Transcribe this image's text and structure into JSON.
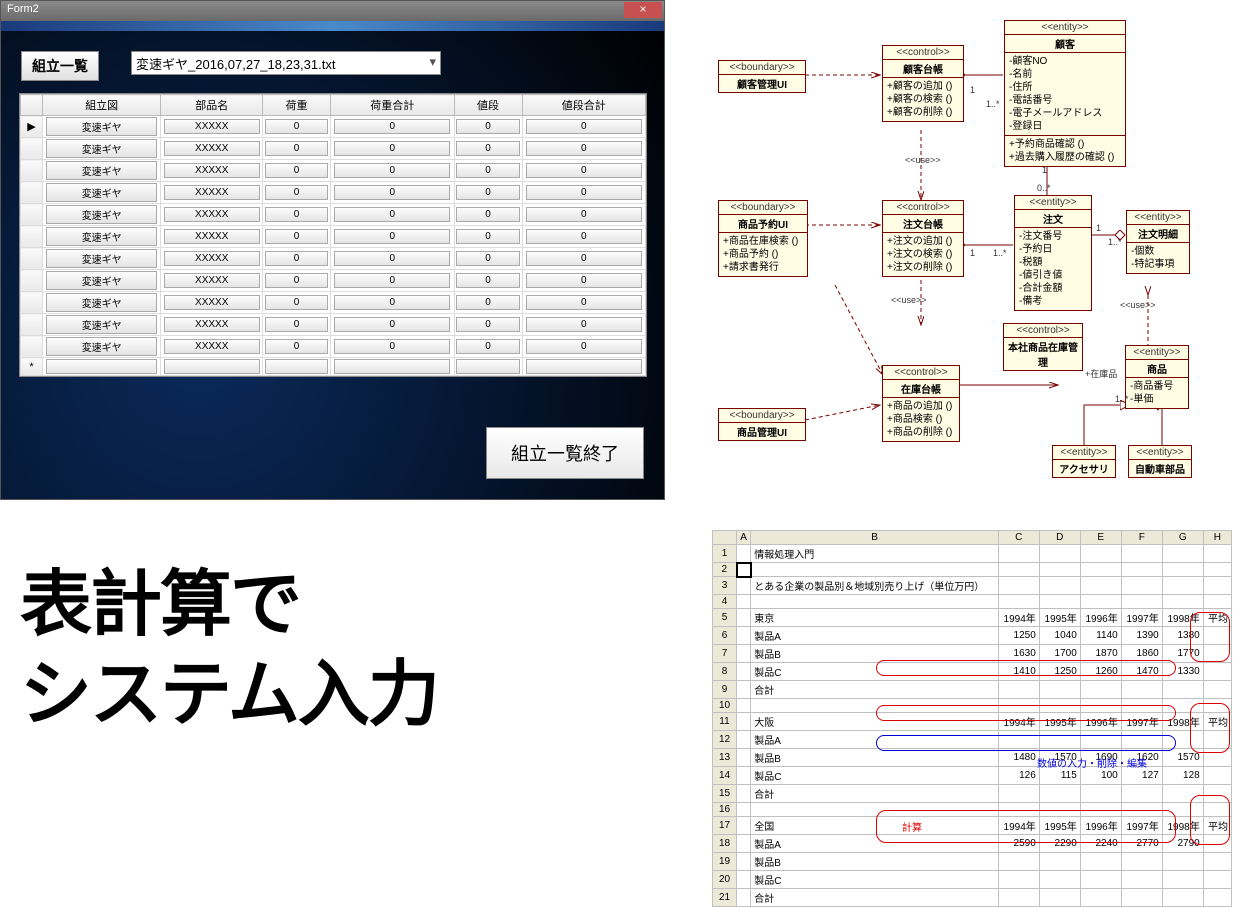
{
  "winform": {
    "title": "Form2",
    "close": "×",
    "list_button": "組立一覧",
    "combo_value": "変速ギヤ_2016,07,27_18,23,31.txt",
    "headers": [
      "組立図",
      "部品名",
      "荷重",
      "荷重合計",
      "値段",
      "値段合計"
    ],
    "row_marker": "▶",
    "new_marker": "*",
    "rows": [
      {
        "c": [
          "変速ギヤ",
          "XXXXX",
          "0",
          "0",
          "0",
          "0"
        ]
      },
      {
        "c": [
          "変速ギヤ",
          "XXXXX",
          "0",
          "0",
          "0",
          "0"
        ]
      },
      {
        "c": [
          "変速ギヤ",
          "XXXXX",
          "0",
          "0",
          "0",
          "0"
        ]
      },
      {
        "c": [
          "変速ギヤ",
          "XXXXX",
          "0",
          "0",
          "0",
          "0"
        ]
      },
      {
        "c": [
          "変速ギヤ",
          "XXXXX",
          "0",
          "0",
          "0",
          "0"
        ]
      },
      {
        "c": [
          "変速ギヤ",
          "XXXXX",
          "0",
          "0",
          "0",
          "0"
        ]
      },
      {
        "c": [
          "変速ギヤ",
          "XXXXX",
          "0",
          "0",
          "0",
          "0"
        ]
      },
      {
        "c": [
          "変速ギヤ",
          "XXXXX",
          "0",
          "0",
          "0",
          "0"
        ]
      },
      {
        "c": [
          "変速ギヤ",
          "XXXXX",
          "0",
          "0",
          "0",
          "0"
        ]
      },
      {
        "c": [
          "変速ギヤ",
          "XXXXX",
          "0",
          "0",
          "0",
          "0"
        ]
      },
      {
        "c": [
          "変速ギヤ",
          "XXXXX",
          "0",
          "0",
          "0",
          "0"
        ]
      }
    ],
    "end_button": "組立一覧終了"
  },
  "uml": {
    "boxes": {
      "b1": {
        "st": "<<boundary>>",
        "nm": "顧客管理UI"
      },
      "b2": {
        "st": "<<boundary>>",
        "nm": "商品予約UI",
        "op": "+商品在庫検索 ()\n+商品予約 ()\n+請求書発行"
      },
      "b3": {
        "st": "<<boundary>>",
        "nm": "商品管理UI"
      },
      "c1": {
        "st": "<<control>>",
        "nm": "顧客台帳",
        "op": "+顧客の追加 ()\n+顧客の検索 ()\n+顧客の削除 ()"
      },
      "c2": {
        "st": "<<control>>",
        "nm": "注文台帳",
        "op": "+注文の追加 ()\n+注文の検索 ()\n+注文の削除 ()"
      },
      "c3": {
        "st": "<<control>>",
        "nm": "本社商品在庫管理"
      },
      "c4": {
        "st": "<<control>>",
        "nm": "在庫台帳",
        "op": "+商品の追加 ()\n+商品検索 ()\n+商品の削除 ()"
      },
      "e1": {
        "st": "<<entity>>",
        "nm": "顧客",
        "at": "-顧客NO\n-名前\n-住所\n-電話番号\n-電子メールアドレス\n-登録日",
        "op": "+予約商品確認 ()\n+過去購入履歴の確認 ()"
      },
      "e2": {
        "st": "<<entity>>",
        "nm": "注文",
        "at": "-注文番号\n-予約日\n-税額\n-値引き値\n-合計金額\n-備考"
      },
      "e3": {
        "st": "<<entity>>",
        "nm": "注文明細",
        "at": "-個数\n-特記事項"
      },
      "e4": {
        "st": "<<entity>>",
        "nm": "商品",
        "at": "-商品番号\n-単価"
      },
      "e5": {
        "st": "<<entity>>",
        "nm": "アクセサリ"
      },
      "e6": {
        "st": "<<entity>>",
        "nm": "自動車部品"
      }
    },
    "labels": {
      "use1": "<<use>>",
      "use2": "<<use>>",
      "use3": "<<use>>",
      "m1": "1",
      "m2": "1..*",
      "m3": "1",
      "m4": "0..*",
      "m5": "1",
      "m6": "1..*",
      "m7": "1",
      "m8": "1..*",
      "m9": "1..*",
      "stock": "+在庫品"
    }
  },
  "bigtitle": {
    "line1": "表計算で",
    "line2": "システム入力"
  },
  "sheet": {
    "cols": [
      "A",
      "B",
      "C",
      "D",
      "E",
      "F",
      "G",
      "H"
    ],
    "rows": [
      {
        "n": "1",
        "c": [
          "",
          "情報処理入門",
          "",
          "",
          "",
          "",
          "",
          ""
        ]
      },
      {
        "n": "2",
        "c": [
          "",
          "",
          "",
          "",
          "",
          "",
          "",
          ""
        ]
      },
      {
        "n": "3",
        "c": [
          "",
          "とある企業の製品別＆地域別売り上げ（単位万円）",
          "",
          "",
          "",
          "",
          "",
          ""
        ]
      },
      {
        "n": "4",
        "c": [
          "",
          "",
          "",
          "",
          "",
          "",
          "",
          ""
        ]
      },
      {
        "n": "5",
        "c": [
          "",
          "東京",
          "1994年",
          "1995年",
          "1996年",
          "1997年",
          "1998年",
          "平均"
        ]
      },
      {
        "n": "6",
        "c": [
          "",
          "製品A",
          "1250",
          "1040",
          "1140",
          "1390",
          "1380",
          ""
        ]
      },
      {
        "n": "7",
        "c": [
          "",
          "製品B",
          "1630",
          "1700",
          "1870",
          "1860",
          "1770",
          ""
        ]
      },
      {
        "n": "8",
        "c": [
          "",
          "製品C",
          "1410",
          "1250",
          "1260",
          "1470",
          "1330",
          ""
        ]
      },
      {
        "n": "9",
        "c": [
          "",
          "合計",
          "",
          "",
          "",
          "",
          "",
          ""
        ]
      },
      {
        "n": "10",
        "c": [
          "",
          "",
          "",
          "",
          "",
          "",
          "",
          ""
        ]
      },
      {
        "n": "11",
        "c": [
          "",
          "大阪",
          "1994年",
          "1995年",
          "1996年",
          "1997年",
          "1998年",
          "平均"
        ]
      },
      {
        "n": "12",
        "c": [
          "",
          "製品A",
          "",
          "",
          "",
          "",
          "",
          ""
        ]
      },
      {
        "n": "13",
        "c": [
          "",
          "製品B",
          "1480",
          "1570",
          "1690",
          "1620",
          "1570",
          ""
        ]
      },
      {
        "n": "14",
        "c": [
          "",
          "製品C",
          "126",
          "115",
          "100",
          "127",
          "128",
          ""
        ]
      },
      {
        "n": "15",
        "c": [
          "",
          "合計",
          "",
          "",
          "",
          "",
          "",
          ""
        ]
      },
      {
        "n": "16",
        "c": [
          "",
          "",
          "",
          "",
          "",
          "",
          "",
          ""
        ]
      },
      {
        "n": "17",
        "c": [
          "",
          "全国",
          "1994年",
          "1995年",
          "1996年",
          "1997年",
          "1998年",
          "平均"
        ]
      },
      {
        "n": "18",
        "c": [
          "",
          "製品A",
          "2590",
          "2290",
          "2240",
          "2770",
          "2790",
          ""
        ]
      },
      {
        "n": "19",
        "c": [
          "",
          "製品B",
          "",
          "",
          "",
          "",
          "",
          ""
        ]
      },
      {
        "n": "20",
        "c": [
          "",
          "製品C",
          "",
          "",
          "",
          "",
          "",
          ""
        ]
      },
      {
        "n": "21",
        "c": [
          "",
          "合計",
          "",
          "",
          "",
          "",
          "",
          ""
        ]
      }
    ],
    "notes": {
      "calc": "計算",
      "edit": "数値の入力・削除・編集"
    }
  }
}
